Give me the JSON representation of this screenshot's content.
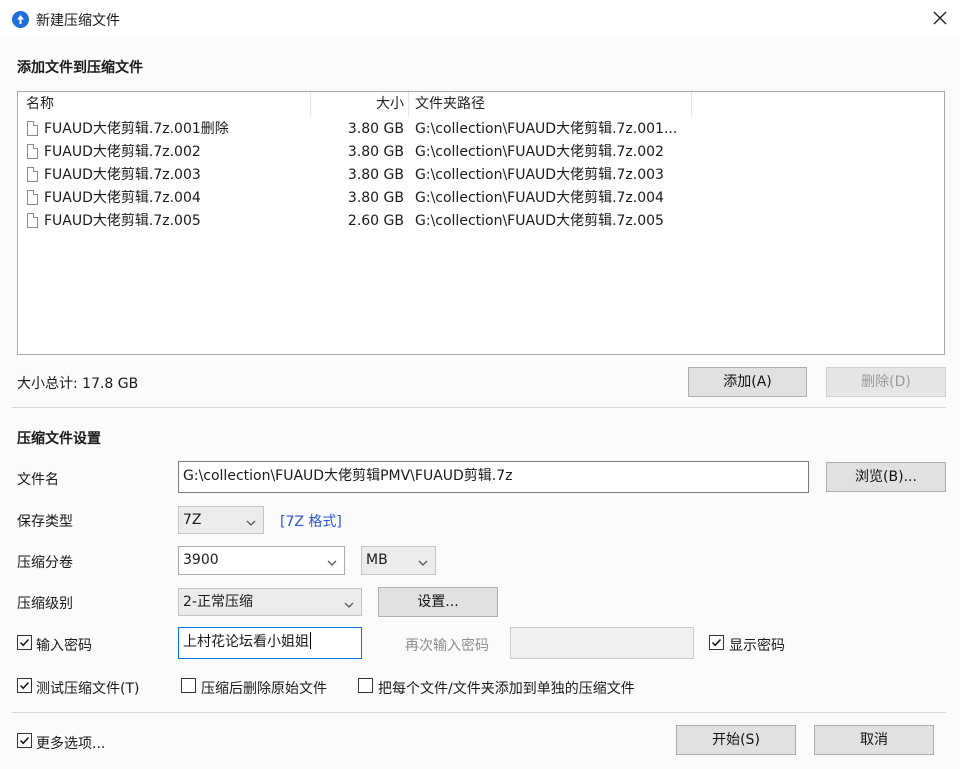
{
  "window": {
    "title": "新建压缩文件"
  },
  "add_section": {
    "title": "添加文件到压缩文件",
    "columns": {
      "name": "名称",
      "size": "大小",
      "path": "文件夹路径"
    },
    "files": [
      {
        "name": "FUAUD大佬剪辑.7z.001删除",
        "size": "3.80 GB",
        "path": "G:\\collection\\FUAUD大佬剪辑.7z.001..."
      },
      {
        "name": "FUAUD大佬剪辑.7z.002",
        "size": "3.80 GB",
        "path": "G:\\collection\\FUAUD大佬剪辑.7z.002"
      },
      {
        "name": "FUAUD大佬剪辑.7z.003",
        "size": "3.80 GB",
        "path": "G:\\collection\\FUAUD大佬剪辑.7z.003"
      },
      {
        "name": "FUAUD大佬剪辑.7z.004",
        "size": "3.80 GB",
        "path": "G:\\collection\\FUAUD大佬剪辑.7z.004"
      },
      {
        "name": "FUAUD大佬剪辑.7z.005",
        "size": "2.60 GB",
        "path": "G:\\collection\\FUAUD大佬剪辑.7z.005"
      }
    ],
    "total_size": "大小总计: 17.8 GB",
    "add_button": "添加(A)",
    "delete_button": "删除(D)"
  },
  "settings": {
    "title": "压缩文件设置",
    "filename_label": "文件名",
    "filename_value": "G:\\collection\\FUAUD大佬剪辑PMV\\FUAUD剪辑.7z",
    "browse_button": "浏览(B)...",
    "save_type_label": "保存类型",
    "save_type_value": "7Z",
    "format_link": "[7Z 格式]",
    "split_label": "压缩分卷",
    "split_value": "3900",
    "split_unit": "MB",
    "level_label": "压缩级别",
    "level_value": "2-正常压缩",
    "settings_button": "设置...",
    "password_label": "输入密码",
    "password_value": "上村花论坛看小姐姐",
    "password_confirm_label": "再次输入密码",
    "show_password_label": "显示密码",
    "test_label": "测试压缩文件(T)",
    "delete_after_label": "压缩后删除原始文件",
    "separate_label": "把每个文件/文件夹添加到单独的压缩文件"
  },
  "footer": {
    "more_options_label": "更多选项...",
    "start_button": "开始(S)",
    "cancel_button": "取消"
  },
  "colors": {
    "accent": "#0078d7",
    "link": "#2a55d8",
    "app_icon": "#1e6fd9"
  },
  "checkboxes": {
    "password": true,
    "show_password": true,
    "test": true,
    "delete_after": false,
    "separate": false,
    "more_options": true
  }
}
